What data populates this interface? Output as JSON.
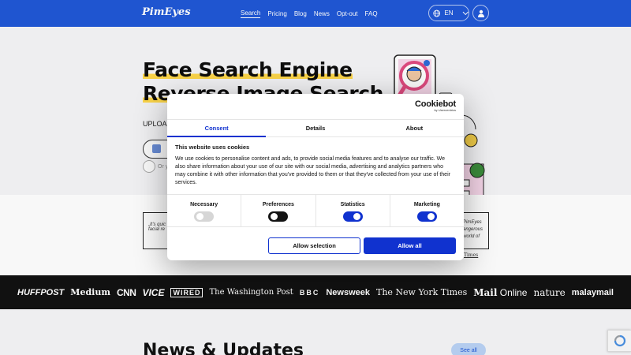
{
  "header": {
    "logo": "PimEyes",
    "nav": [
      "Search",
      "Pricing",
      "Blog",
      "News",
      "Opt-out",
      "FAQ"
    ],
    "language": "EN"
  },
  "hero": {
    "title_line1": "Face Search Engine",
    "title_line2": "Reverse Image Search",
    "upload_label": "UPLOAD",
    "or_text": "Or y"
  },
  "quotes": {
    "left": "„It's quic facial re",
    "right_lines": [
      "PimEyes",
      "angerous",
      "world of"
    ],
    "source": "Times"
  },
  "press_logos": [
    "HUFFPOST",
    "Medium",
    "CNN",
    "VICE",
    "WIRED",
    "The Washington Post",
    "BBC",
    "Newsweek",
    "The New York Times",
    "Mail",
    "Online",
    "nature",
    "malaymail"
  ],
  "news": {
    "title": "News & Updates",
    "see_all": "See all"
  },
  "cookie_dialog": {
    "brand": "Cookiebot",
    "brand_sub": "by Usercentrics",
    "tabs": [
      "Consent",
      "Details",
      "About"
    ],
    "active_tab": "Consent",
    "heading": "This website uses cookies",
    "text": "We use cookies to personalise content and ads, to provide social media features and to analyse our traffic. We also share information about your use of our site with our social media, advertising and analytics partners who may combine it with other information that you've provided to them or that they've collected from your use of their services.",
    "toggles": [
      {
        "label": "Necessary",
        "state": "disabled-on"
      },
      {
        "label": "Preferences",
        "state": "off"
      },
      {
        "label": "Statistics",
        "state": "on"
      },
      {
        "label": "Marketing",
        "state": "on"
      }
    ],
    "allow_selection": "Allow selection",
    "allow_all": "Allow all"
  },
  "colors": {
    "header_blue": "#1f57d6",
    "cookie_blue": "#1032cf",
    "highlight_yellow": "#ffd84a"
  }
}
